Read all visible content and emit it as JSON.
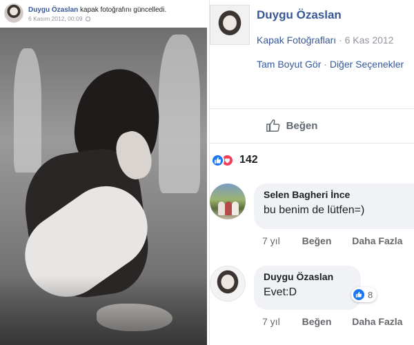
{
  "post": {
    "author": "Duygu Özaslan",
    "action": " kapak fotoğrafını güncelledi.",
    "timestamp": "6 Kasım 2012, 00:09",
    "privacy_icon": "globe-icon"
  },
  "photo_info": {
    "owner_name": "Duygu Özaslan",
    "album": "Kapak Fotoğrafları",
    "separator": " · ",
    "date": "6 Kas 2012",
    "full_size_link": "Tam Boyut Gör",
    "more_options_link": "Diğer Seçenekler"
  },
  "like_button": {
    "label": "Beğen",
    "icon": "thumbs-up-outline-icon"
  },
  "reactions": {
    "types": [
      "like",
      "love"
    ],
    "count": "142",
    "colors": {
      "like": "#1877f2",
      "love": "#f33e58"
    }
  },
  "comments": [
    {
      "author": "Selen Bagheri İnce",
      "text": "bu benim de lütfen=)",
      "time": "7 yıl",
      "like_label": "Beğen",
      "more_label": "Daha Fazla"
    },
    {
      "author": "Duygu Özaslan",
      "text": "Evet:D",
      "reaction_count": "8",
      "time": "7 yıl",
      "like_label": "Beğen",
      "more_label": "Daha Fazla"
    }
  ],
  "colors": {
    "link": "#365899",
    "meta": "#90949c",
    "bubble": "#f0f2f5"
  }
}
